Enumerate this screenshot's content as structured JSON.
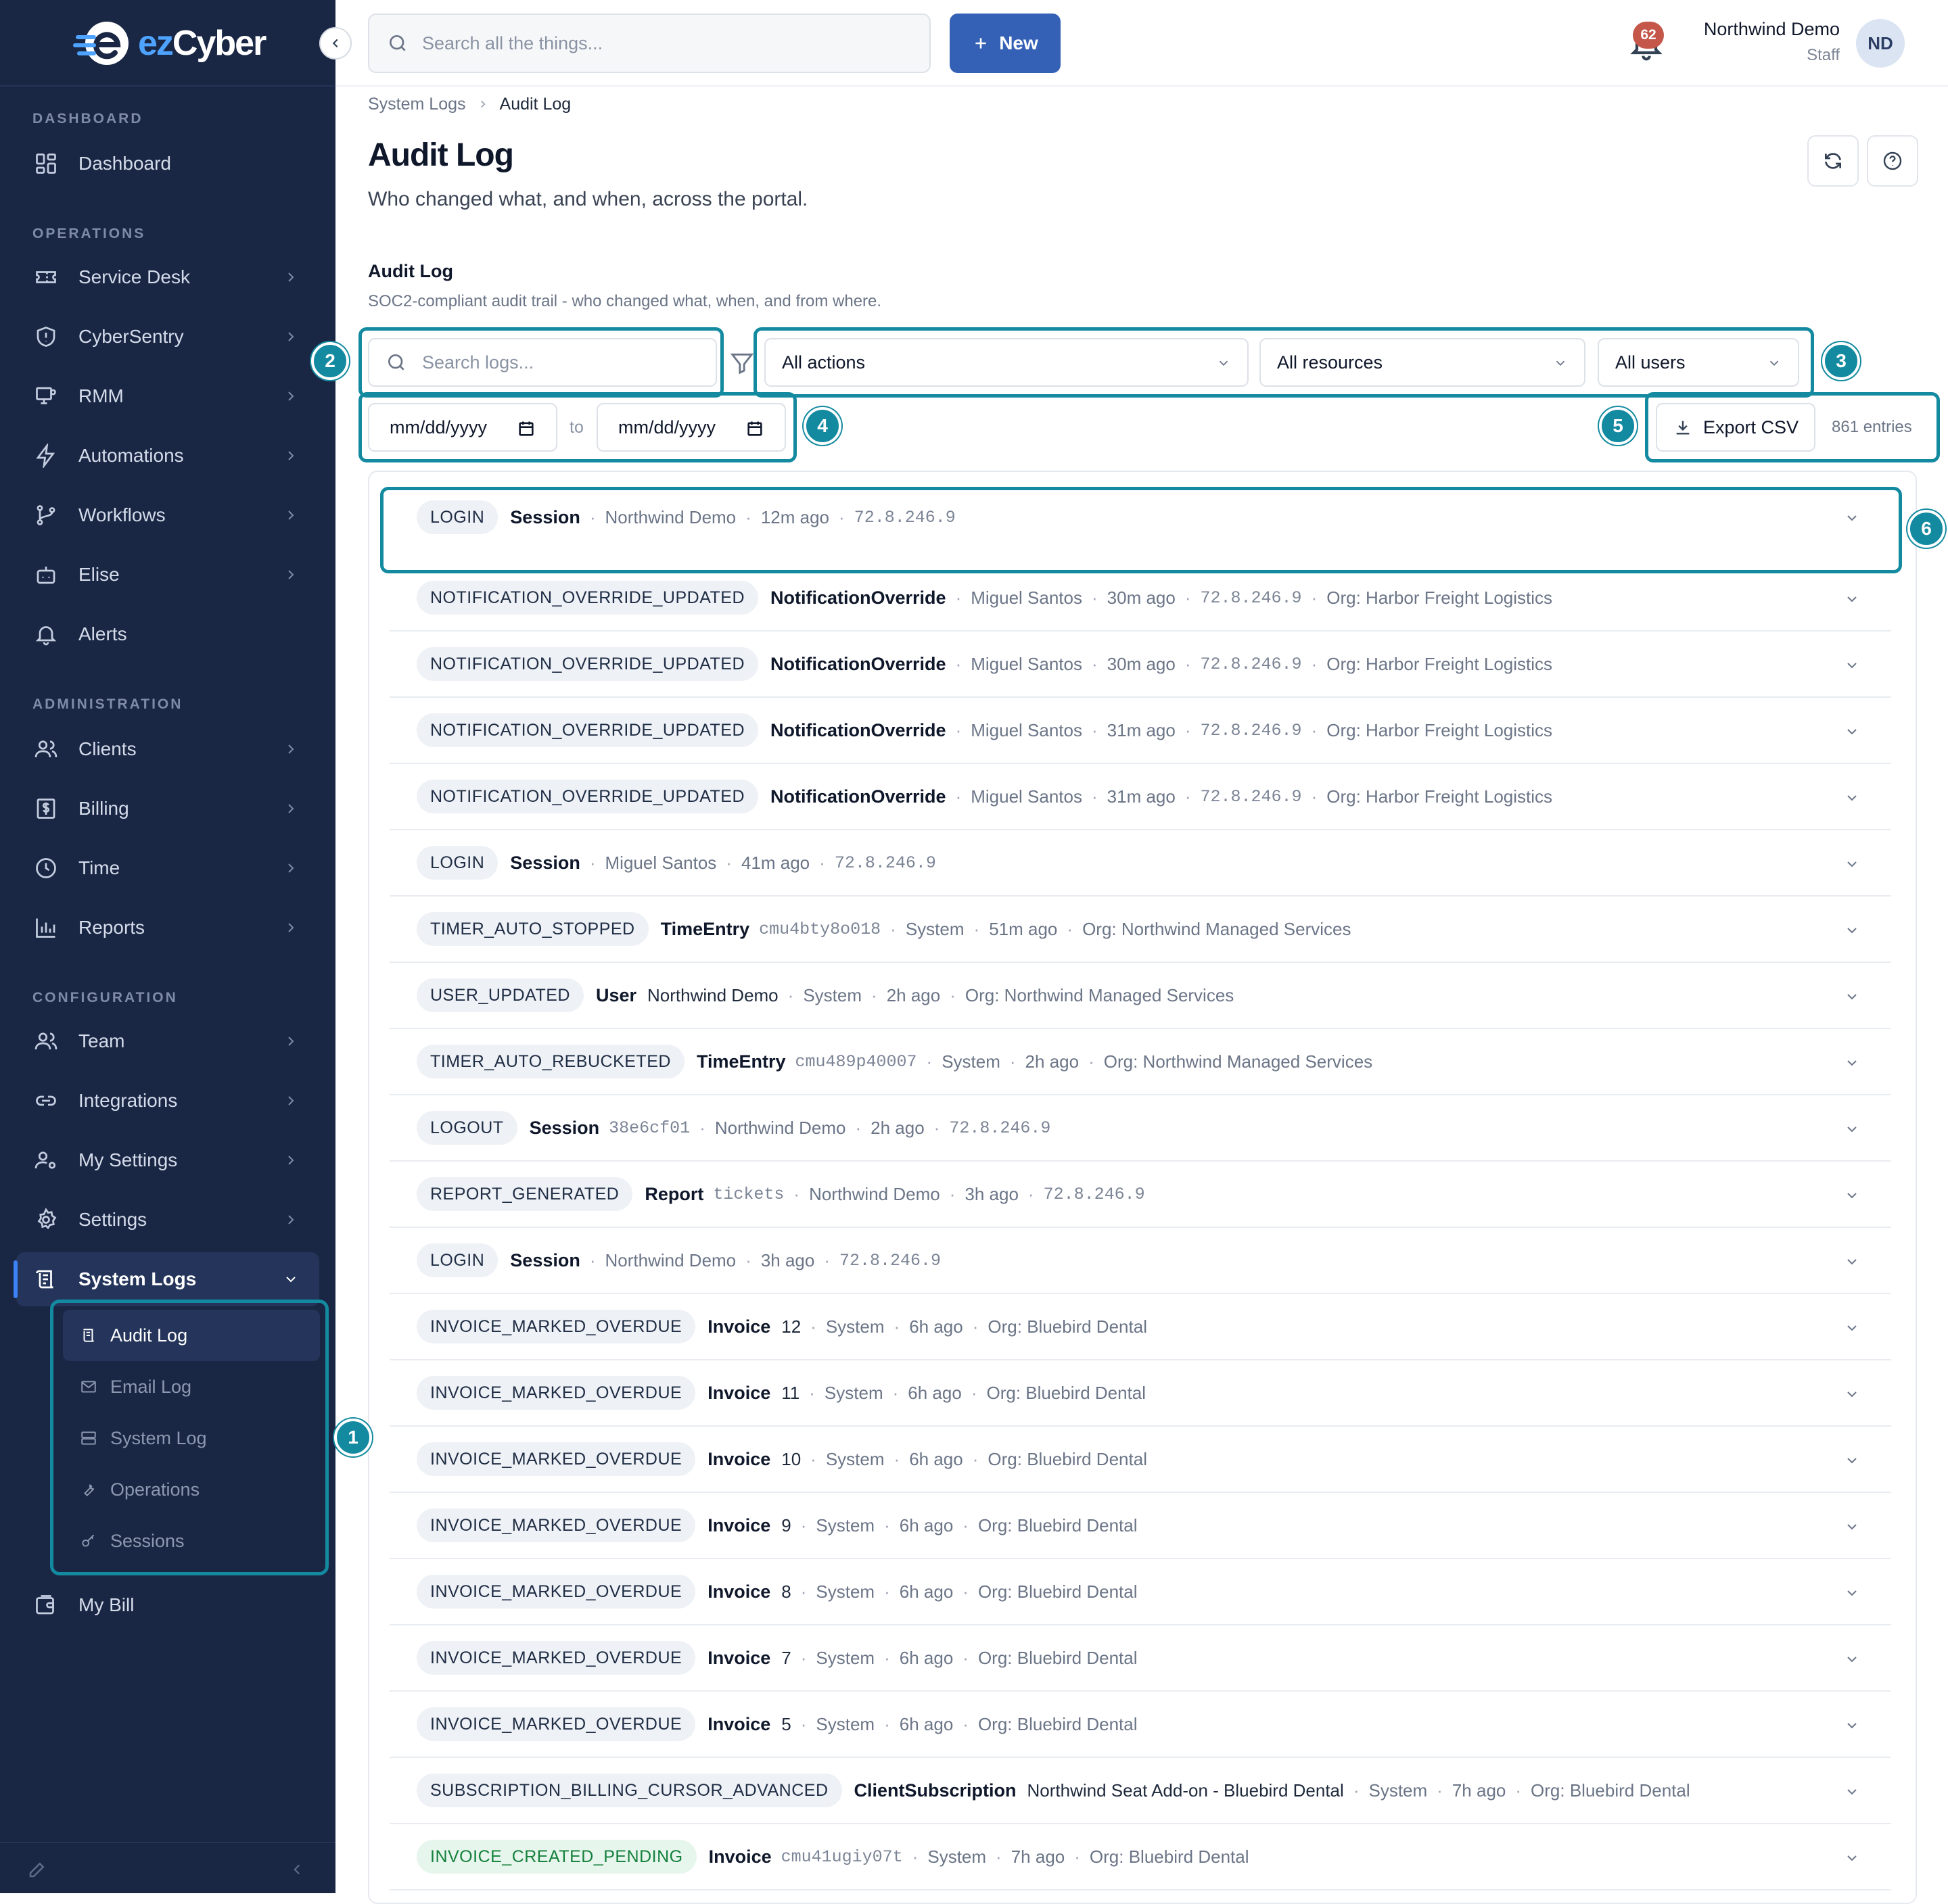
{
  "brand": {
    "name_prefix": "ez",
    "name_suffix": "Cyber"
  },
  "colors": {
    "sidebar": "#1a2744",
    "accent": "#3461b5",
    "highlight": "#138aa0",
    "badge_bg": "#eef1f5",
    "green_badge": "#15803d",
    "notification": "#c4574a"
  },
  "sidebar": {
    "sections": {
      "dashboard": "DASHBOARD",
      "operations": "OPERATIONS",
      "administration": "ADMINISTRATION",
      "configuration": "CONFIGURATION"
    },
    "items": {
      "dashboard": "Dashboard",
      "service_desk": "Service Desk",
      "cybersentry": "CyberSentry",
      "rmm": "RMM",
      "automations": "Automations",
      "workflows": "Workflows",
      "elise": "Elise",
      "alerts": "Alerts",
      "clients": "Clients",
      "billing": "Billing",
      "time": "Time",
      "reports": "Reports",
      "team": "Team",
      "integrations": "Integrations",
      "my_settings": "My Settings",
      "settings": "Settings",
      "system_logs": "System Logs",
      "my_bill": "My Bill"
    },
    "sub_items": {
      "audit_log": "Audit Log",
      "email_log": "Email Log",
      "system_log": "System Log",
      "operations": "Operations",
      "sessions": "Sessions"
    }
  },
  "topbar": {
    "search_placeholder": "Search all the things...",
    "new_label": "New",
    "notifications": "62",
    "user_name": "Northwind Demo",
    "user_role": "Staff",
    "avatar_initials": "ND"
  },
  "breadcrumb": {
    "parent": "System Logs",
    "current": "Audit Log"
  },
  "page": {
    "title": "Audit Log",
    "subtitle": "Who changed what, and when, across the portal."
  },
  "section": {
    "title": "Audit Log",
    "subtitle": "SOC2-compliant audit trail - who changed what, when, and from where."
  },
  "filters": {
    "search_placeholder": "Search logs...",
    "actions": "All actions",
    "resources": "All resources",
    "users": "All users",
    "date_from": "mm/dd/yyyy",
    "date_to": "mm/dd/yyyy",
    "to_label": "to",
    "export_label": "Export CSV",
    "entries": "861 entries"
  },
  "callouts": {
    "c1": "1",
    "c2": "2",
    "c3": "3",
    "c4": "4",
    "c5": "5",
    "c6": "6"
  },
  "logs": [
    {
      "action": "LOGIN",
      "resource": "Session",
      "actor": "Northwind Demo",
      "time": "12m ago",
      "ip": "72.8.246.9"
    },
    {
      "action": "NOTIFICATION_OVERRIDE_UPDATED",
      "resource": "NotificationOverride",
      "actor": "Miguel Santos",
      "time": "30m ago",
      "ip": "72.8.246.9",
      "org": "Org: Harbor Freight Logistics"
    },
    {
      "action": "NOTIFICATION_OVERRIDE_UPDATED",
      "resource": "NotificationOverride",
      "actor": "Miguel Santos",
      "time": "30m ago",
      "ip": "72.8.246.9",
      "org": "Org: Harbor Freight Logistics"
    },
    {
      "action": "NOTIFICATION_OVERRIDE_UPDATED",
      "resource": "NotificationOverride",
      "actor": "Miguel Santos",
      "time": "31m ago",
      "ip": "72.8.246.9",
      "org": "Org: Harbor Freight Logistics"
    },
    {
      "action": "NOTIFICATION_OVERRIDE_UPDATED",
      "resource": "NotificationOverride",
      "actor": "Miguel Santos",
      "time": "31m ago",
      "ip": "72.8.246.9",
      "org": "Org: Harbor Freight Logistics"
    },
    {
      "action": "LOGIN",
      "resource": "Session",
      "actor": "Miguel Santos",
      "time": "41m ago",
      "ip": "72.8.246.9"
    },
    {
      "action": "TIMER_AUTO_STOPPED",
      "resource": "TimeEntry",
      "id": "cmu4bty8o018",
      "actor": "System",
      "time": "51m ago",
      "org": "Org: Northwind Managed Services"
    },
    {
      "action": "USER_UPDATED",
      "resource": "User",
      "name": "Northwind Demo",
      "actor": "System",
      "time": "2h ago",
      "org": "Org: Northwind Managed Services"
    },
    {
      "action": "TIMER_AUTO_REBUCKETED",
      "resource": "TimeEntry",
      "id": "cmu489p40007",
      "actor": "System",
      "time": "2h ago",
      "org": "Org: Northwind Managed Services"
    },
    {
      "action": "LOGOUT",
      "resource": "Session",
      "id": "38e6cf01",
      "actor": "Northwind Demo",
      "time": "2h ago",
      "ip": "72.8.246.9"
    },
    {
      "action": "REPORT_GENERATED",
      "resource": "Report",
      "id": "tickets",
      "actor": "Northwind Demo",
      "time": "3h ago",
      "ip": "72.8.246.9"
    },
    {
      "action": "LOGIN",
      "resource": "Session",
      "actor": "Northwind Demo",
      "time": "3h ago",
      "ip": "72.8.246.9"
    },
    {
      "action": "INVOICE_MARKED_OVERDUE",
      "resource": "Invoice",
      "name": "12",
      "actor": "System",
      "time": "6h ago",
      "org": "Org: Bluebird Dental"
    },
    {
      "action": "INVOICE_MARKED_OVERDUE",
      "resource": "Invoice",
      "name": "11",
      "actor": "System",
      "time": "6h ago",
      "org": "Org: Bluebird Dental"
    },
    {
      "action": "INVOICE_MARKED_OVERDUE",
      "resource": "Invoice",
      "name": "10",
      "actor": "System",
      "time": "6h ago",
      "org": "Org: Bluebird Dental"
    },
    {
      "action": "INVOICE_MARKED_OVERDUE",
      "resource": "Invoice",
      "name": "9",
      "actor": "System",
      "time": "6h ago",
      "org": "Org: Bluebird Dental"
    },
    {
      "action": "INVOICE_MARKED_OVERDUE",
      "resource": "Invoice",
      "name": "8",
      "actor": "System",
      "time": "6h ago",
      "org": "Org: Bluebird Dental"
    },
    {
      "action": "INVOICE_MARKED_OVERDUE",
      "resource": "Invoice",
      "name": "7",
      "actor": "System",
      "time": "6h ago",
      "org": "Org: Bluebird Dental"
    },
    {
      "action": "INVOICE_MARKED_OVERDUE",
      "resource": "Invoice",
      "name": "5",
      "actor": "System",
      "time": "6h ago",
      "org": "Org: Bluebird Dental"
    },
    {
      "action": "SUBSCRIPTION_BILLING_CURSOR_ADVANCED",
      "resource": "ClientSubscription",
      "name": "Northwind Seat Add-on - Bluebird Dental",
      "actor": "System",
      "time": "7h ago",
      "org": "Org: Bluebird Dental"
    },
    {
      "action": "INVOICE_CREATED_PENDING",
      "resource": "Invoice",
      "id": "cmu41ugiy07t",
      "actor": "System",
      "time": "7h ago",
      "org": "Org: Bluebird Dental",
      "green": true
    }
  ]
}
